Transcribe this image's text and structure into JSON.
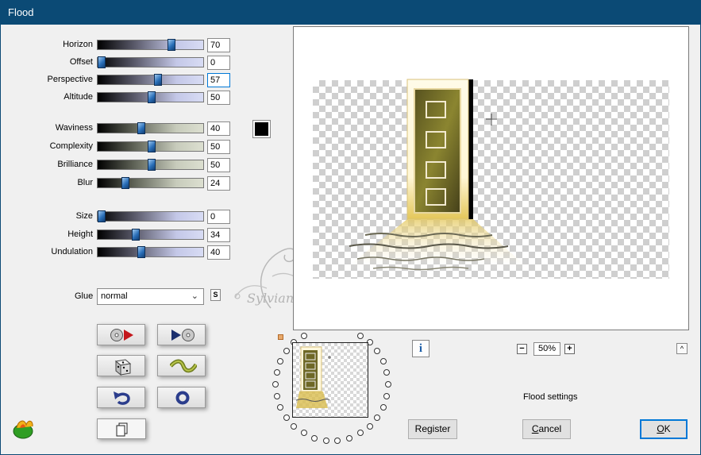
{
  "window": {
    "title": "Flood"
  },
  "sliders": [
    {
      "label": "Horizon",
      "value": "70",
      "fraction": 0.7,
      "track": "blue",
      "focused": false
    },
    {
      "label": "Offset",
      "value": "0",
      "fraction": 0.0,
      "track": "blue",
      "focused": false
    },
    {
      "label": "Perspective",
      "value": "57",
      "fraction": 0.57,
      "track": "blue",
      "focused": true
    },
    {
      "label": "Altitude",
      "value": "50",
      "fraction": 0.5,
      "track": "blue",
      "focused": false
    },
    {
      "label": "Waviness",
      "value": "40",
      "fraction": 0.4,
      "track": "green",
      "focused": false
    },
    {
      "label": "Complexity",
      "value": "50",
      "fraction": 0.5,
      "track": "green",
      "focused": false
    },
    {
      "label": "Brilliance",
      "value": "50",
      "fraction": 0.5,
      "track": "green",
      "focused": false
    },
    {
      "label": "Blur",
      "value": "24",
      "fraction": 0.24,
      "track": "green",
      "focused": false
    },
    {
      "label": "Size",
      "value": "0",
      "fraction": 0.0,
      "track": "blue",
      "focused": false
    },
    {
      "label": "Height",
      "value": "34",
      "fraction": 0.34,
      "track": "blue",
      "focused": false
    },
    {
      "label": "Undulation",
      "value": "40",
      "fraction": 0.4,
      "track": "blue",
      "focused": false
    }
  ],
  "color_swatch": {
    "color": "#000000"
  },
  "glue": {
    "label": "Glue",
    "value": "normal",
    "s_label": "S"
  },
  "watermark_text": "Sylviane",
  "zoom": {
    "value": "50%",
    "minus": "−",
    "plus": "+"
  },
  "info_label": "i",
  "caret_label": "^",
  "status": "Flood settings",
  "buttons": {
    "register": "Register",
    "cancel_rest": "ancel",
    "cancel_u": "C",
    "ok_u": "O",
    "ok_rest": "K"
  },
  "colors": {
    "titlebar": "#0b4a75",
    "accent": "#0078d7"
  }
}
